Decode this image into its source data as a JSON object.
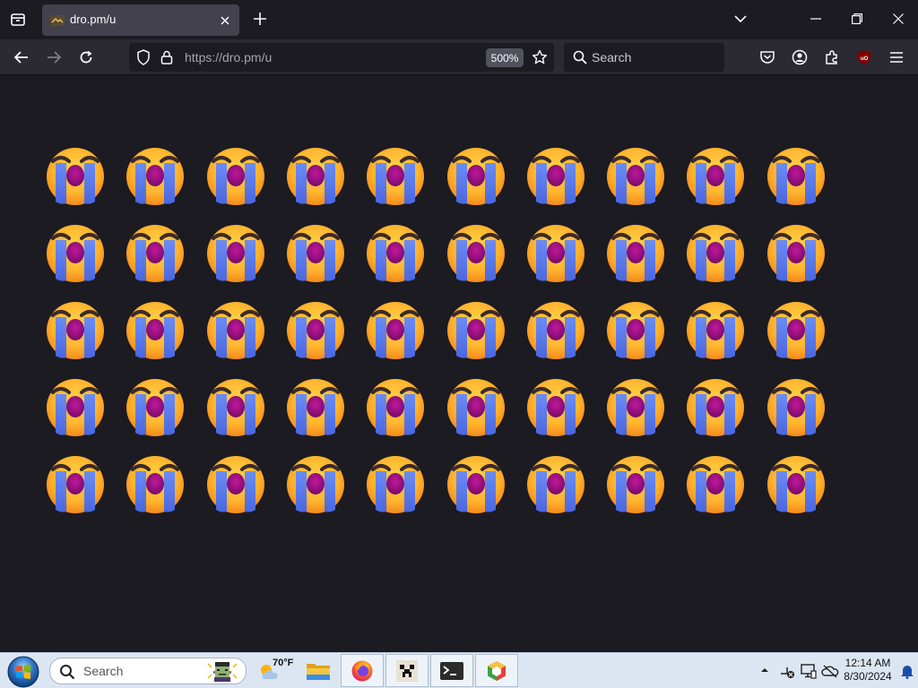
{
  "browser": {
    "tab": {
      "title": "dro.pm/u"
    },
    "url": "https://dro.pm/u",
    "zoom": "500%",
    "search_placeholder": "Search"
  },
  "page": {
    "emoji": "loudly-crying-face",
    "rows": 5,
    "columns": 10
  },
  "taskbar": {
    "search_placeholder": "Search",
    "weather_temp": "70°F",
    "apps": [
      "file-explorer",
      "firefox",
      "minecraft",
      "terminal",
      "cube-app"
    ],
    "clock_time": "12:14 AM",
    "clock_date": "8/30/2024"
  },
  "colors": {
    "page_bg": "#1c1b22",
    "toolbar_bg": "#2b2a33",
    "active_tab": "#42414d",
    "taskbar_bg": "#dce6f2"
  }
}
